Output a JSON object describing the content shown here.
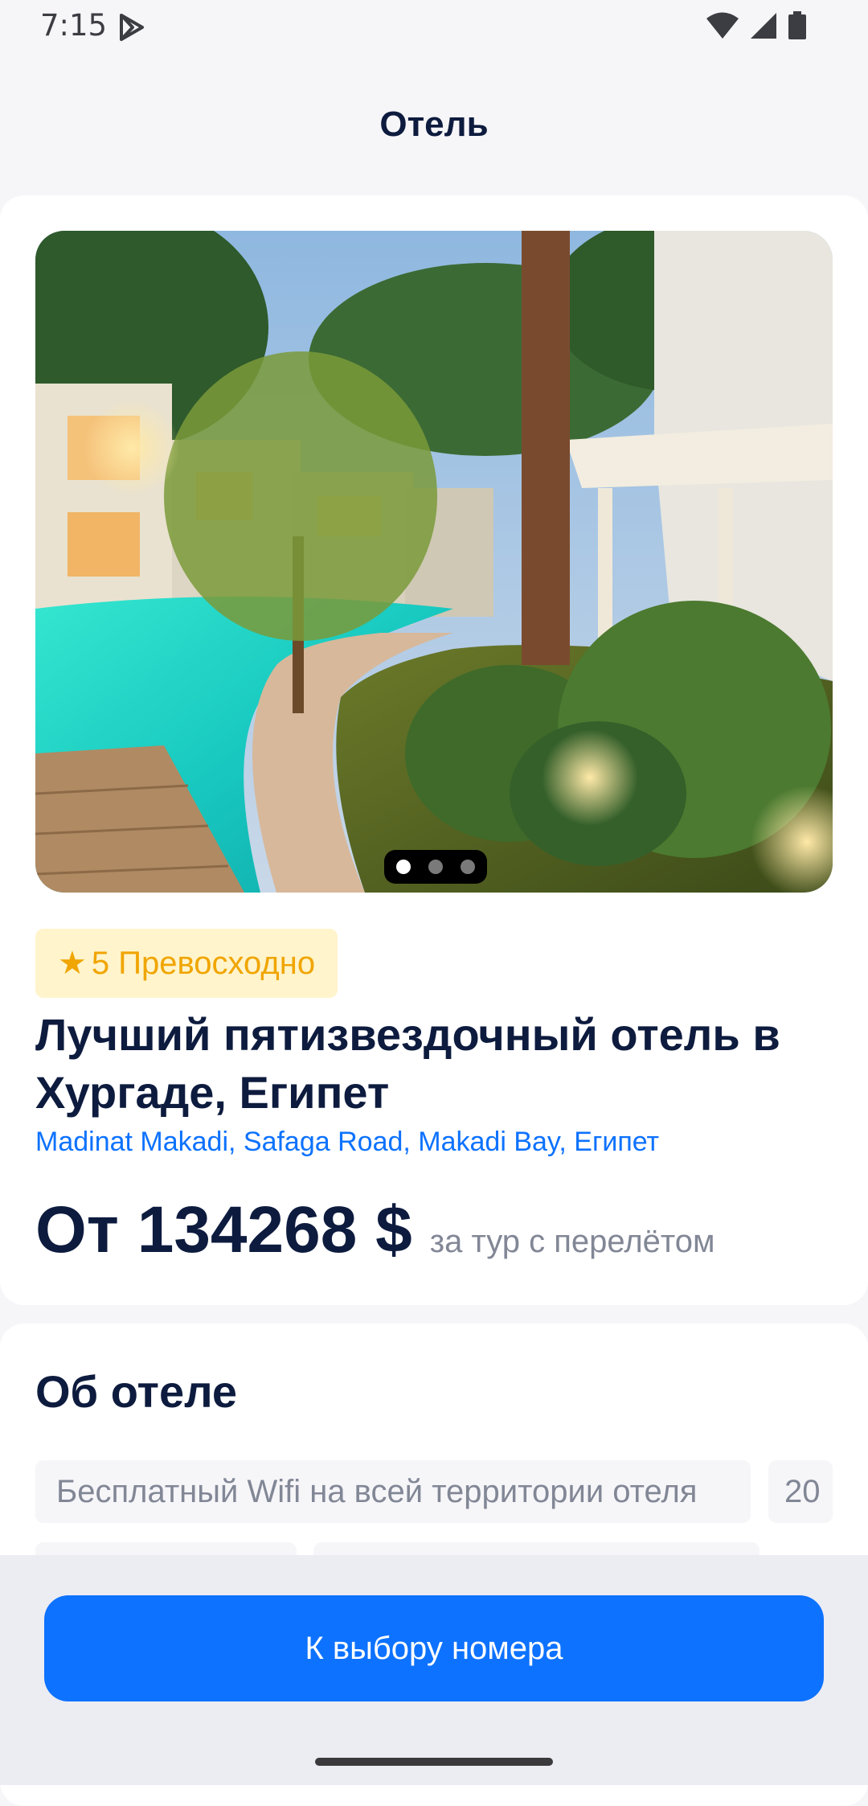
{
  "status_bar": {
    "time": "7:15"
  },
  "header": {
    "title": "Отель"
  },
  "hotel": {
    "rating": "5 Превосходно",
    "name": "Лучший пятизвездочный отель в Хургаде, Египет",
    "address": "Madinat Makadi, Safaga Road, Makadi Bay, Египет",
    "price": "От 134268 $",
    "price_note": "за тур с перелётом",
    "gallery": {
      "total_images": 3,
      "active_index": 0
    }
  },
  "about": {
    "title": "Об отеле",
    "peculiarities": [
      "Бесплатный Wifi на всей территории отеля",
      "20"
    ]
  },
  "actions": {
    "primary_button": "К выбору номера"
  },
  "colors": {
    "accent": "#0d72ff",
    "text_primary": "#0d1b3e",
    "text_secondary": "#828796",
    "rating_text": "#f0a500",
    "rating_background": "#fff4cc",
    "background": "#f6f6f9"
  }
}
